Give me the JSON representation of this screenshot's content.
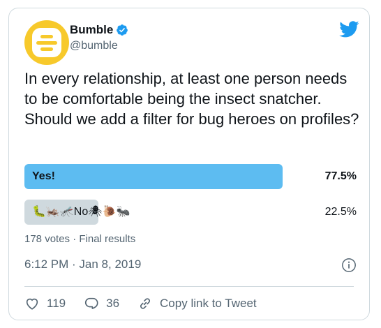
{
  "account": {
    "name": "Bumble",
    "handle": "@bumble",
    "verified": true,
    "avatar_color": "#f7c92b"
  },
  "tweet": {
    "text": "In every relationship, at least one person needs to be comfortable being the insect snatcher. Should we add a filter for bug heroes on profiles?"
  },
  "poll": {
    "options": [
      {
        "label": "Yes!",
        "percent_text": "77.5%",
        "percent": 77.5,
        "winner": true,
        "color": "#5dbcf1"
      },
      {
        "label": "🐛🦗🦟No🕷🐌🐜",
        "percent_text": "22.5%",
        "percent": 22.5,
        "winner": false,
        "color": "#cfd9de"
      }
    ],
    "summary": "178 votes · Final results"
  },
  "meta": {
    "timestamp": "6:12 PM · Jan 8, 2019"
  },
  "actions": {
    "likes": "119",
    "replies": "36",
    "copy_link": "Copy link to Tweet"
  },
  "colors": {
    "twitter_blue": "#1d9bf0",
    "text_secondary": "#536471"
  },
  "icons": [
    "twitter-logo-icon",
    "verified-badge-icon",
    "info-icon",
    "heart-icon",
    "reply-icon",
    "link-icon"
  ]
}
